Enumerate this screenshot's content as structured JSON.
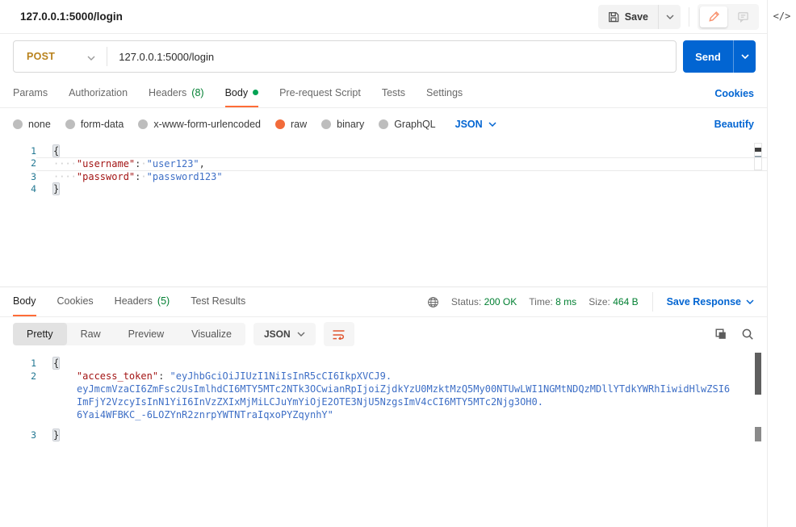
{
  "colors": {
    "accent": "#FF6C37",
    "link": "#0265D2",
    "success": "#007F31",
    "method_post": "#B9821D",
    "key": "#A31515",
    "string_value": "#3E6FC6"
  },
  "icons": {
    "save": "floppy-disk",
    "edit": "pencil",
    "comment": "speech-bubble",
    "code": "</>",
    "globe": "globe",
    "copy": "copy",
    "search": "magnifier",
    "wrap": "wrap-lines",
    "chevron": "chevron-down"
  },
  "topbar": {
    "title": "127.0.0.1:5000/login",
    "save_label": "Save"
  },
  "request": {
    "method": "POST",
    "url": "127.0.0.1:5000/login",
    "send_label": "Send"
  },
  "request_tabs": {
    "items": [
      {
        "label": "Params"
      },
      {
        "label": "Authorization"
      },
      {
        "label": "Headers",
        "count": "(8)"
      },
      {
        "label": "Body"
      },
      {
        "label": "Pre-request Script"
      },
      {
        "label": "Tests"
      },
      {
        "label": "Settings"
      }
    ],
    "active": "Body",
    "cookies_link": "Cookies"
  },
  "body_types": {
    "items": [
      "none",
      "form-data",
      "x-www-form-urlencoded",
      "raw",
      "binary",
      "GraphQL"
    ],
    "selected": "raw",
    "format": "JSON",
    "beautify_link": "Beautify"
  },
  "request_editor": {
    "line_numbers": [
      "1",
      "2",
      "3",
      "4"
    ],
    "l1": {
      "brace": "{"
    },
    "l2": {
      "indent": "····",
      "key": "\"username\"",
      "colon": ":",
      "sp": "·",
      "value": "\"user123\"",
      "comma": ","
    },
    "l3": {
      "indent": "····",
      "key": "\"password\"",
      "colon": ":",
      "sp": "·",
      "value": "\"password123\""
    },
    "l4": {
      "brace": "}"
    }
  },
  "response_tabs": {
    "items": [
      {
        "label": "Body"
      },
      {
        "label": "Cookies"
      },
      {
        "label": "Headers",
        "count": "(5)"
      },
      {
        "label": "Test Results"
      }
    ],
    "active": "Body"
  },
  "response_meta": {
    "status_label": "Status:",
    "status_value": "200 OK",
    "time_label": "Time:",
    "time_value": "8 ms",
    "size_label": "Size:",
    "size_value": "464 B",
    "save_response": "Save Response"
  },
  "response_toolbar": {
    "views": [
      "Pretty",
      "Raw",
      "Preview",
      "Visualize"
    ],
    "active": "Pretty",
    "format": "JSON"
  },
  "response_editor": {
    "nums": [
      "1",
      "2",
      "3"
    ],
    "l1_brace": "{",
    "indent": "    ",
    "key": "\"access_token\"",
    "colon": ":",
    "value_line": "\"eyJhbGciOiJIUzI1NiIsInR5cCI6IkpXVCJ9.",
    "wraps": [
      "eyJmcmVzaCI6ZmFsc2UsImlhdCI6MTY5MTc2NTk3OCwianRpIjoiZjdkYzU0MzktMzQ5My00NTUwLWI1NGMtNDQzMDllYTdkYWRhIiwidHlwZSI6",
      "ImFjY2VzcyIsInN1YiI6InVzZXIxMjMiLCJuYmYiOjE2OTE3NjU5NzgsImV4cCI6MTY5MTc2Njg3OH0.",
      "6Yai4WFBKC_-6LOZYnR2znrpYWTNTraIqxoPYZqynhY\""
    ],
    "l3_brace": "}"
  }
}
